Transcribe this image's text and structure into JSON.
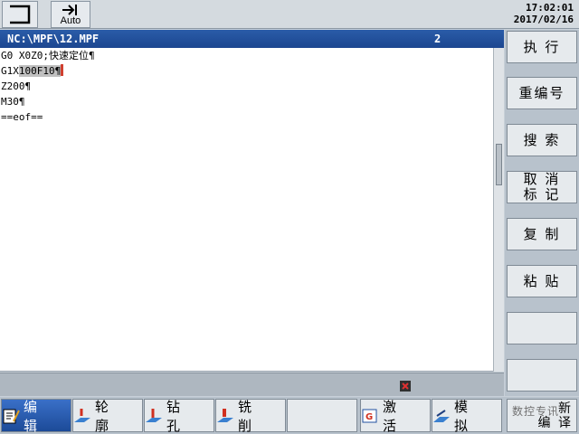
{
  "topbar": {
    "auto_label": "Auto",
    "time": "17:02:01",
    "date": "2017/02/16"
  },
  "editor": {
    "file_path": "NC:\\MPF\\12.MPF",
    "channel": "2",
    "lines": {
      "line1": "G0 X0Z0;快速定位¶",
      "line2_pre": "G1X",
      "line2_sel": "100F10",
      "line2_post": "¶",
      "line3": "Z200¶",
      "line4": "M30¶",
      "line5": "==eof=="
    }
  },
  "vertical_softkeys": {
    "execute": "执 行",
    "renumber": "重编号",
    "search": "搜 索",
    "unmark_1": "取 消",
    "unmark_2": "标 记",
    "copy": "复 制",
    "paste": "粘 贴"
  },
  "horizontal_softkeys": {
    "edit": "编 辑",
    "contour": "轮 廓",
    "drill": "钻 孔",
    "mill": "铣 削",
    "activate": "激 活",
    "simulate": "模 拟",
    "new_1": "新",
    "new_2": "编 译"
  },
  "watermark": "数控专讯",
  "colors": {
    "title_bar": "#1c4690",
    "active_tab": "#2a60b8",
    "selection": "#c0c0c0",
    "cursor": "#d04030"
  },
  "icons": {
    "menu": "bracket-icon",
    "auto": "arrow-into-bar-icon",
    "status": "alarm-x-icon"
  }
}
